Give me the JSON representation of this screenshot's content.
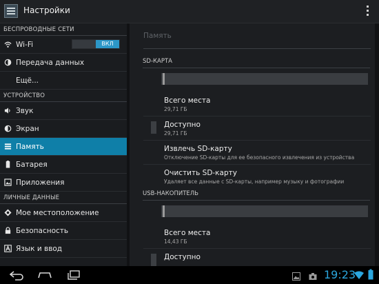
{
  "app": {
    "title": "Настройки"
  },
  "sidebar": {
    "sections": [
      {
        "header": "БЕСПРОВОДНЫЕ СЕТИ",
        "items": [
          {
            "label": "Wi-Fi",
            "icon": "wifi-icon",
            "toggle": "ВКЛ"
          },
          {
            "label": "Передача данных",
            "icon": "data-usage-icon"
          },
          {
            "label": "Ещё..."
          }
        ]
      },
      {
        "header": "УСТРОЙСТВО",
        "items": [
          {
            "label": "Звук",
            "icon": "sound-icon"
          },
          {
            "label": "Экран",
            "icon": "display-icon"
          },
          {
            "label": "Память",
            "icon": "storage-icon",
            "active": true
          },
          {
            "label": "Батарея",
            "icon": "battery-icon"
          },
          {
            "label": "Приложения",
            "icon": "apps-icon"
          }
        ]
      },
      {
        "header": "ЛИЧНЫЕ ДАННЫЕ",
        "items": [
          {
            "label": "Мое местоположение",
            "icon": "location-icon"
          },
          {
            "label": "Безопасность",
            "icon": "lock-icon"
          },
          {
            "label": "Язык и ввод",
            "icon": "language-icon"
          }
        ]
      }
    ]
  },
  "main": {
    "title": "Память",
    "sd": {
      "header": "SD-КАРТА",
      "total_label": "Всего места",
      "total_value": "29,71 ГБ",
      "available_label": "Доступно",
      "available_value": "29,71 ГБ",
      "eject_title": "Извлечь SD-карту",
      "eject_sub": "Отключение SD-карты для ее безопасного извлечения из устройства",
      "clear_title": "Очистить SD-карту",
      "clear_sub": "Удаляет все данные с SD-карты, например музыку и фотографии"
    },
    "usb": {
      "header": "USB-НАКОПИТЕЛЬ",
      "total_label": "Всего места",
      "total_value": "14,43 ГБ",
      "available_label": "Доступно"
    }
  },
  "navbar": {
    "time": "19:23"
  },
  "colors": {
    "accent": "#0f7fa8",
    "toggle_on": "#2c97c7",
    "clock": "#2ba6de"
  }
}
